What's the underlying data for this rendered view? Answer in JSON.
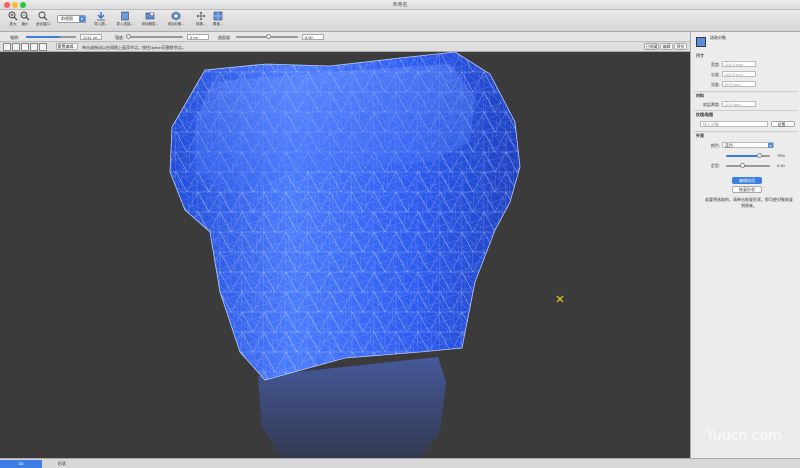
{
  "window": {
    "title": "未命名"
  },
  "toolbar": {
    "zoom_in": "放大",
    "zoom_out": "缩小",
    "fit_window": "适合窗口",
    "view_select": "前视图",
    "import": "导入图...",
    "import_mesh": "导入连接...",
    "add_layer": "添加格层...",
    "add_object": "添加对象...",
    "transform": "转换...",
    "grid": "覆盖..."
  },
  "options": {
    "brush_label": "笔刷:",
    "brush_value": "1211 mi",
    "strength_label": "强度:",
    "strength_value": "0 mi",
    "curvature_label": "曲面度:",
    "curvature_value": "5.00"
  },
  "subbar": {
    "mode_button": "重置编辑...",
    "hint": "单击或拖动以在网格上面添节点。按住Option可删除节点。",
    "tab1": "已隐藏",
    "tab2": "编辑",
    "tab3": "预览"
  },
  "panel": {
    "header": "选取对象",
    "size_section": "尺寸",
    "width_label": "宽度:",
    "width_value": "100.0 mm",
    "height_label": "长度:",
    "height_value": "100.0 mm",
    "depth_label": "深度:",
    "depth_value": "60.0 mm",
    "material_section": "材料",
    "material_label": "底层厚度:",
    "material_value": "10.0 mm",
    "texture_section": "纹理/贴图",
    "texture_field": "插入对象",
    "texture_button": "设置...",
    "appearance_section": "外观",
    "appearance_label": "颜色:",
    "appearance_value": "蓝色",
    "opacity_value": "75%",
    "gloss_label": "定型:",
    "gloss_value": "0.40",
    "apply_button": "编辑选项",
    "restore_button": "恢复形状",
    "note": "若要将选取的，请单击恢复形状，即可使对象恢复到原来。"
  },
  "status": {
    "tab_3d": "3D",
    "tab_2d": "3D",
    "tab_shape": "形状"
  },
  "watermark": "Yuucn.com"
}
